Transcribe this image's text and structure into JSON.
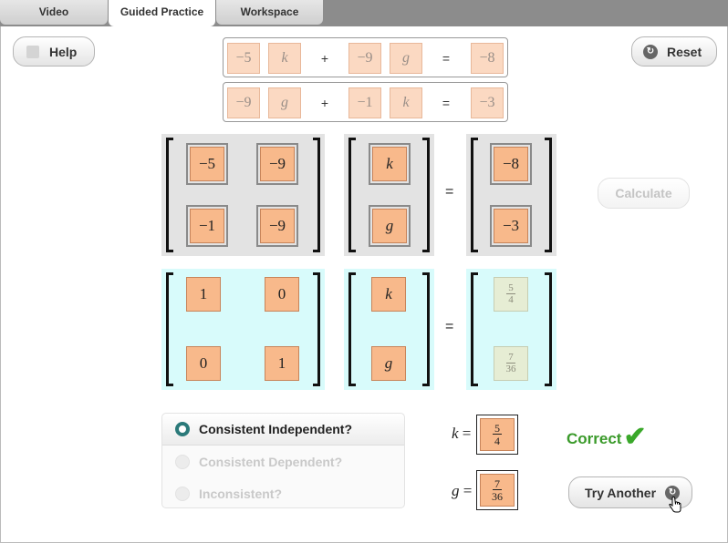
{
  "tabs": [
    "Video",
    "Guided Practice",
    "Workspace"
  ],
  "buttons": {
    "help": "Help",
    "reset": "Reset",
    "calculate": "Calculate",
    "try_another": "Try Another"
  },
  "equations": [
    {
      "a": "−5",
      "x": "k",
      "op": "+",
      "b": "−9",
      "y": "g",
      "eq": "=",
      "c": "−8"
    },
    {
      "a": "−9",
      "x": "g",
      "op": "+",
      "b": "−1",
      "y": "k",
      "eq": "=",
      "c": "−3"
    }
  ],
  "matrix_system": {
    "coefficients": [
      "−5",
      "−9",
      "−1",
      "−9"
    ],
    "variables": [
      "k",
      "g"
    ],
    "constants": [
      "−8",
      "−3"
    ],
    "equals": "="
  },
  "reduced_system": {
    "identity": [
      "1",
      "0",
      "0",
      "1"
    ],
    "variables": [
      "k",
      "g"
    ],
    "solution": [
      {
        "num": "5",
        "den": "4"
      },
      {
        "num": "7",
        "den": "36"
      }
    ],
    "equals": "="
  },
  "options": [
    {
      "label": "Consistent Independent?",
      "selected": true
    },
    {
      "label": "Consistent Dependent?",
      "selected": false
    },
    {
      "label": "Inconsistent?",
      "selected": false
    }
  ],
  "results": {
    "k": {
      "var": "k",
      "eq": "=",
      "num": "5",
      "den": "4"
    },
    "g": {
      "var": "g",
      "eq": "=",
      "num": "7",
      "den": "36"
    }
  },
  "feedback": "Correct",
  "colors": {
    "tile": "#f8b98b",
    "gray_bg": "#e3e3e3",
    "cyan_bg": "#d8fbfb",
    "correct": "#3a9a2a",
    "radio": "#2b7a7a"
  },
  "icons": {
    "reset": "circle-arrow-icon",
    "try_another": "circle-arrow-icon",
    "correct": "checkmark-icon",
    "cursor": "hand-pointer-icon"
  }
}
